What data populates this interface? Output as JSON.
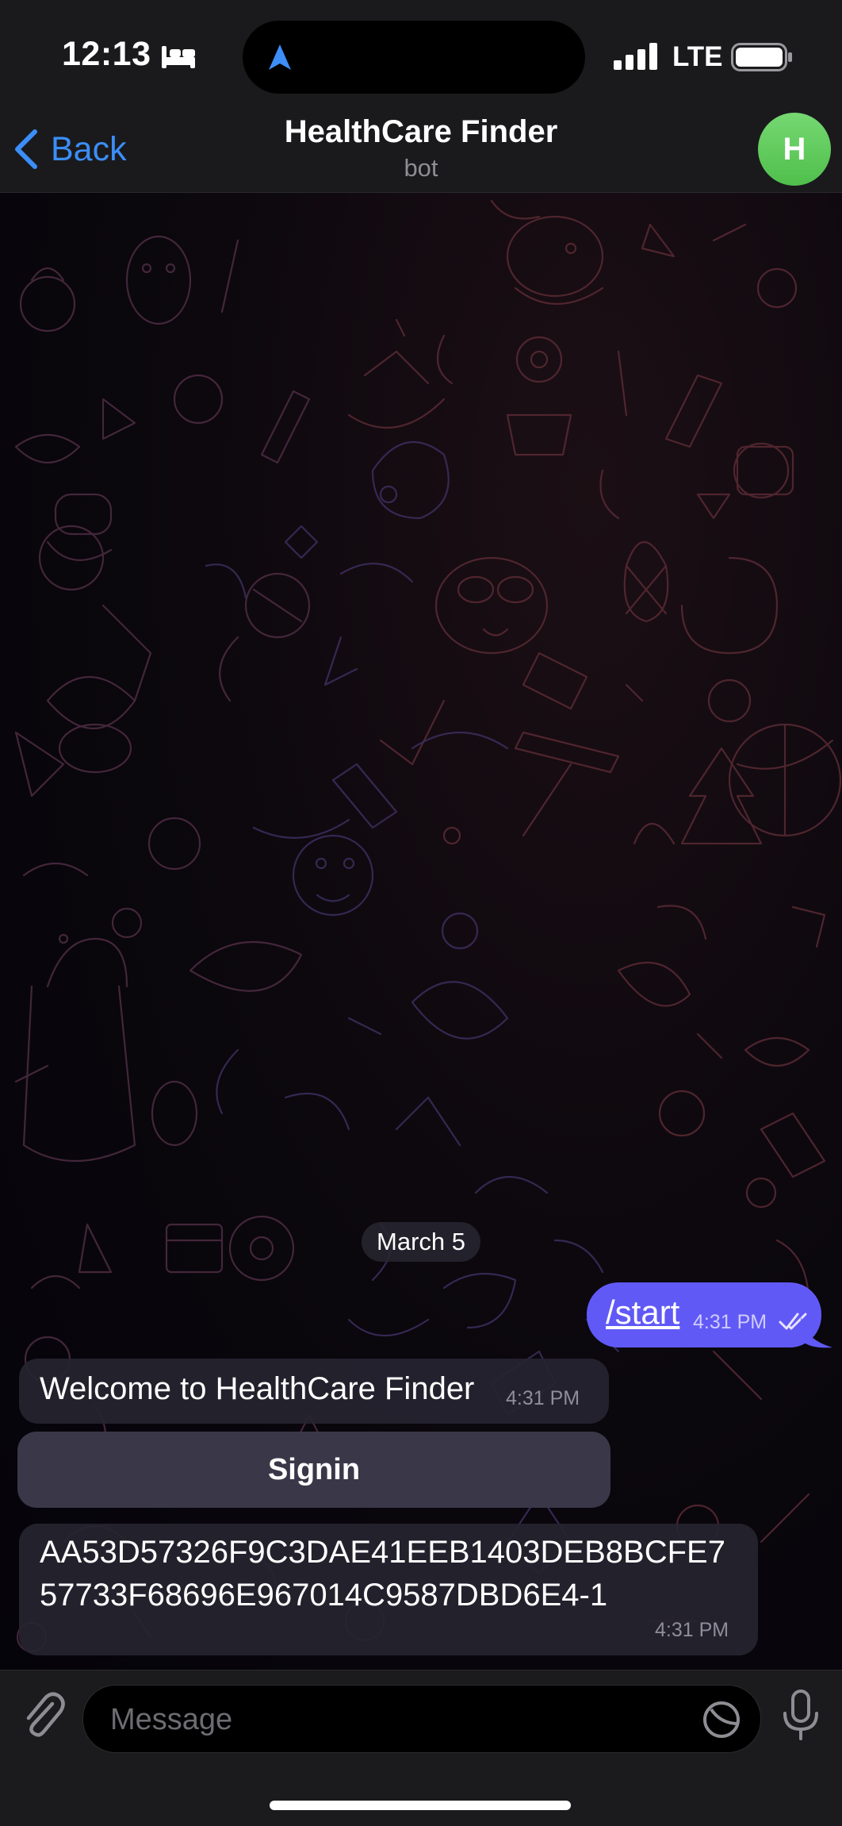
{
  "status_bar": {
    "time": "12:13",
    "network": "LTE",
    "icons": [
      "bed-icon",
      "location-arrow-icon",
      "signal-icon",
      "battery-icon"
    ]
  },
  "header": {
    "back_label": "Back",
    "title": "HealthCare Finder",
    "subtitle": "bot",
    "avatar_letter": "H",
    "avatar_color": "#5cc957"
  },
  "chat": {
    "date_label": "March 5",
    "messages": [
      {
        "direction": "outgoing",
        "text": "/start",
        "time": "4:31 PM",
        "status": "read"
      },
      {
        "direction": "incoming",
        "text": "Welcome to HealthCare Finder",
        "time": "4:31 PM"
      },
      {
        "direction": "incoming",
        "lines": [
          "AA53D57326F9C3DAE41EEB1403DEB8BCFE7",
          "57733F68696E967014C9587DBD6E4-1"
        ],
        "time": "4:31 PM"
      }
    ],
    "inline_button_label": "Signin"
  },
  "input_bar": {
    "placeholder": "Message",
    "icons": [
      "paperclip-icon",
      "sticker-icon",
      "microphone-icon"
    ]
  },
  "colors": {
    "accent_blue": "#3b8ef7",
    "outgoing_bubble": "#6159f6",
    "incoming_bubble": "#262430",
    "header_bg": "#1a1a1c"
  }
}
